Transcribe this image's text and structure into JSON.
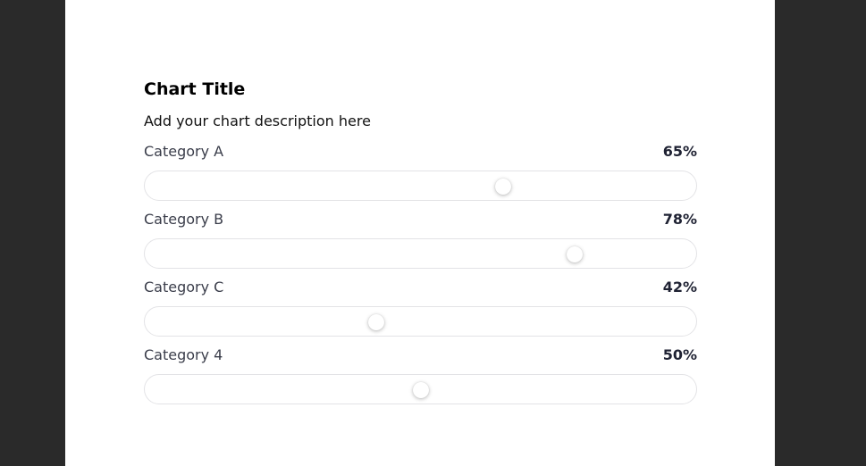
{
  "chart_data": {
    "type": "bar",
    "title": "Chart Title",
    "description": "Add your chart description here",
    "categories": [
      "Category A",
      "Category B",
      "Category C",
      "Category 4"
    ],
    "values": [
      65,
      78,
      42,
      50
    ],
    "value_labels": [
      "65%",
      "78%",
      "42%",
      "50%"
    ],
    "ylim": [
      0,
      100
    ]
  },
  "colors": {
    "background": "#2a2a2a",
    "page": "#ffffff",
    "track_border": "#e3e3e6",
    "label": "#3a3d4a",
    "value": "#1f2233"
  }
}
